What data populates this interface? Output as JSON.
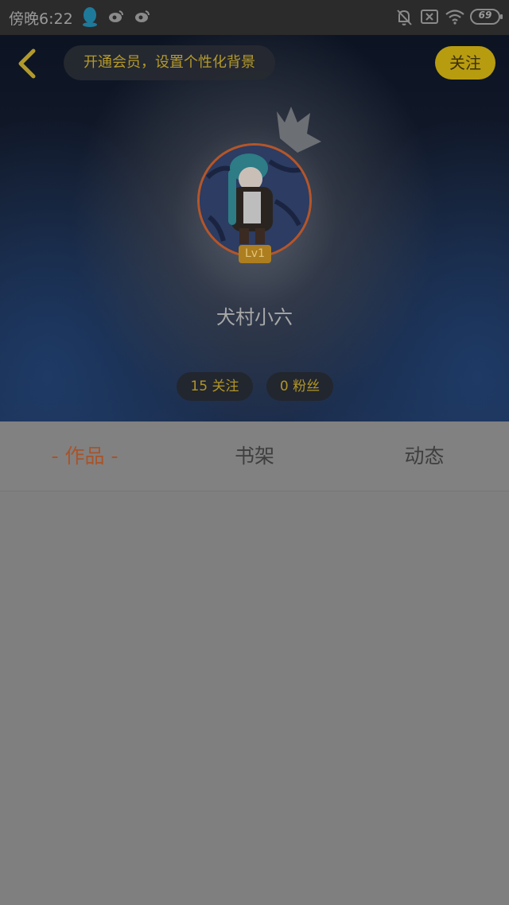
{
  "status_bar": {
    "time": "傍晚6:22",
    "battery": "69",
    "icons": [
      "qq-icon",
      "weibo-icon",
      "weibo-icon",
      "bell-muted-icon",
      "sim-off-icon",
      "wifi-icon",
      "battery-icon"
    ]
  },
  "header": {
    "back_icon": "chevron-left-icon",
    "vip_banner": "开通会员，设置个性化背景",
    "follow_label": "关注",
    "crown_icon": "crown-icon",
    "avatar": "avatar",
    "level": "Lv1",
    "username": "犬村小六",
    "stats": {
      "following": "15 关注",
      "fans": "0 粉丝"
    }
  },
  "tabs": [
    {
      "label": "- 作品 -",
      "active": true
    },
    {
      "label": "书架",
      "active": false
    },
    {
      "label": "动态",
      "active": false
    }
  ],
  "colors": {
    "accent": "#b89c10",
    "active_tab": "#a8542a",
    "overlay": "#7f7f7f"
  }
}
